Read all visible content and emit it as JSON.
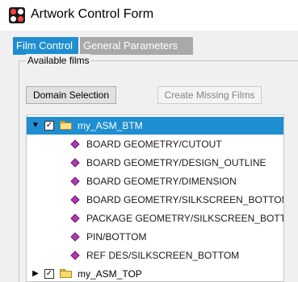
{
  "window": {
    "title": "Artwork Control Form"
  },
  "tabs": [
    {
      "label": "Film Control",
      "active": true
    },
    {
      "label": "General Parameters",
      "active": false
    }
  ],
  "group": {
    "label": "Available films"
  },
  "buttons": {
    "domain_selection": "Domain Selection",
    "create_missing_films": "Create Missing Films"
  },
  "tree": {
    "nodes": [
      {
        "label": "my_ASM_BTM",
        "expanded": true,
        "checked": true,
        "selected": true,
        "icon": "folder-open-icon",
        "children": [
          {
            "label": "BOARD GEOMETRY/CUTOUT",
            "icon": "layer-icon"
          },
          {
            "label": "BOARD GEOMETRY/DESIGN_OUTLINE",
            "icon": "layer-icon"
          },
          {
            "label": "BOARD GEOMETRY/DIMENSION",
            "icon": "layer-icon"
          },
          {
            "label": "BOARD GEOMETRY/SILKSCREEN_BOTTOM",
            "icon": "layer-icon"
          },
          {
            "label": "PACKAGE GEOMETRY/SILKSCREEN_BOTTOM",
            "icon": "layer-icon"
          },
          {
            "label": "PIN/BOTTOM",
            "icon": "layer-icon"
          },
          {
            "label": "REF DES/SILKSCREEN_BOTTOM",
            "icon": "layer-icon"
          }
        ]
      },
      {
        "label": "my_ASM_TOP",
        "expanded": false,
        "checked": true,
        "selected": false,
        "icon": "folder-icon"
      }
    ]
  },
  "colors": {
    "selection": "#1e8ed0",
    "inactive_tab": "#a9a9a9",
    "layer_icon": "#b03ab0",
    "folder": "#f7d86c"
  }
}
